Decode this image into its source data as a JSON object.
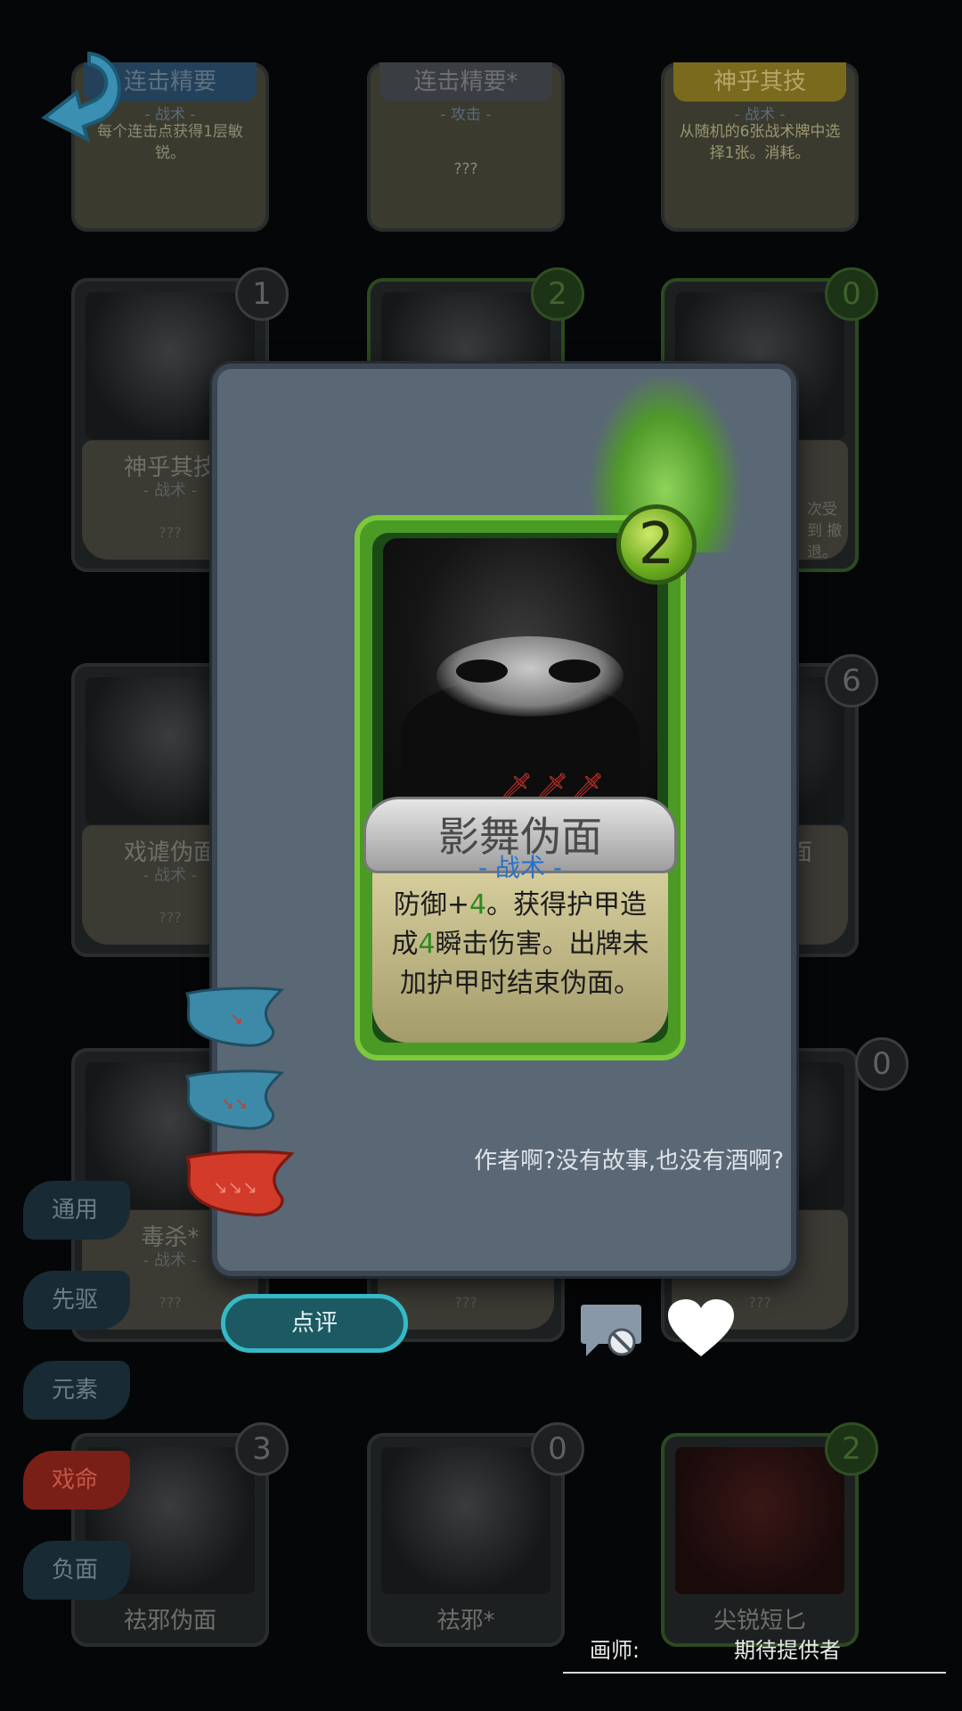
{
  "top_cards": [
    {
      "title": "连击精要",
      "type": "- 战术 -",
      "desc": "每个连击点获得1层敏锐。"
    },
    {
      "title": "连击精要*",
      "type": "- 攻击 -",
      "desc": "???"
    },
    {
      "title": "神乎其技",
      "type": "- 战术 -",
      "desc": "从随机的6张战术牌中选择1张。消耗。"
    }
  ],
  "grid_cards": [
    {
      "title": "神乎其技",
      "type": "- 战术 -",
      "desc": "???",
      "cost": "1"
    },
    {
      "title": "",
      "type": "",
      "desc": "",
      "cost": "2"
    },
    {
      "title": "",
      "type": "",
      "desc": "次受到 撤退。",
      "cost": "0"
    },
    {
      "title": "戏谑伪面",
      "type": "- 战术 -",
      "desc": "???",
      "cost": ""
    },
    {
      "title": "",
      "type": "",
      "desc": "",
      "cost": ""
    },
    {
      "title": "面",
      "type": "",
      "desc": "",
      "cost": "6"
    },
    {
      "title": "毒杀*",
      "type": "- 战术 -",
      "desc": "???",
      "cost": ""
    },
    {
      "title": "",
      "type": "",
      "desc": "???",
      "cost": ""
    },
    {
      "title": "",
      "type": "",
      "desc": "???",
      "cost": "0"
    },
    {
      "title": "祛邪伪面",
      "type": "",
      "desc": "",
      "cost": "3"
    },
    {
      "title": "祛邪*",
      "type": "",
      "desc": "",
      "cost": "0"
    },
    {
      "title": "尖锐短匕",
      "type": "",
      "desc": "",
      "cost": "2"
    }
  ],
  "side_tabs": [
    {
      "label": "通用",
      "active": false
    },
    {
      "label": "先驱",
      "active": false
    },
    {
      "label": "元素",
      "active": false
    },
    {
      "label": "戏命",
      "active": true
    },
    {
      "label": "负面",
      "active": false
    }
  ],
  "detail_card": {
    "title": "影舞伪面",
    "type": "- 战术 -",
    "cost": "2",
    "desc_parts": [
      "防御+",
      "4",
      "。获得护甲造成",
      "4",
      "瞬击伤害。出牌未加护甲时结束伪面。"
    ],
    "story": "作者啊?没有故事,也没有酒啊?"
  },
  "upgrade_levels": [
    {
      "level": 1,
      "selected": false
    },
    {
      "level": 2,
      "selected": false
    },
    {
      "level": 3,
      "selected": true
    }
  ],
  "buttons": {
    "review": "点评"
  },
  "artist": {
    "label": "画师:",
    "name": "期待提供者"
  },
  "colors": {
    "accent": "#35b9c6",
    "card_green": "#4a9a25",
    "active_tab": "#7a1f17",
    "modal_bg": "#5a6775"
  },
  "icons": [
    "back-arrow-icon",
    "comment-disabled-icon",
    "heart-icon",
    "flame-icon",
    "dagger-icon",
    "slipper-icon"
  ]
}
